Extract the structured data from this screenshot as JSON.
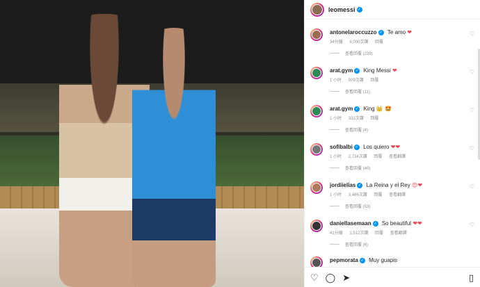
{
  "post": {
    "username": "leomessi",
    "image_alt": "Couple photo at night"
  },
  "comments": [
    {
      "user": "antonelaroccuzzo",
      "text": "Te amo",
      "emoji": "❤",
      "verified": true,
      "time": "34分鐘",
      "likes": "9,000次讚",
      "reply": "回覆",
      "translate": "",
      "replies": "查看回覆 (239)",
      "avatar_color": "#9b6b53"
    },
    {
      "user": "arat.gym",
      "text": "King Messi",
      "emoji": "❤",
      "verified": true,
      "time": "1 小时",
      "likes": "509次讚",
      "reply": "回覆",
      "translate": "",
      "replies": "查看回覆 (11)",
      "avatar_color": "#2e8b57"
    },
    {
      "user": "arat.gym",
      "text": "King",
      "emoji": "👑 🤩",
      "verified": true,
      "time": "1 小时",
      "likes": "332次讚",
      "reply": "回覆",
      "translate": "",
      "replies": "查看回覆 (4)",
      "avatar_color": "#2e8b57"
    },
    {
      "user": "sofibalbi",
      "text": "Los quiero",
      "emoji": "❤❤",
      "verified": true,
      "time": "1 小时",
      "likes": "2,734次讚",
      "reply": "回覆",
      "translate": "查看翻譯",
      "replies": "查看回覆 (40)",
      "avatar_color": "#777777"
    },
    {
      "user": "jordiielias",
      "text": "La Reina y el Rey",
      "emoji": "😍❤",
      "verified": true,
      "time": "1 小时",
      "likes": "3,486次讚",
      "reply": "回覆",
      "translate": "查看翻譯",
      "replies": "查看回覆 (53)",
      "avatar_color": "#b07a5a"
    },
    {
      "user": "daniellasemaan",
      "text": "So beautiful",
      "emoji": "❤❤",
      "verified": true,
      "time": "41分鐘",
      "likes": "1,512次讚",
      "reply": "回覆",
      "translate": "查看翻譯",
      "replies": "查看回覆 (6)",
      "avatar_color": "#333333"
    },
    {
      "user": "pepmorata",
      "text": "Muy guapis",
      "emoji": "",
      "verified": true,
      "time": "",
      "likes": "",
      "reply": "",
      "translate": "",
      "replies": "",
      "avatar_color": "#555555"
    }
  ],
  "footer": {
    "like_icon": "heart-outline-icon",
    "comment_icon": "comment-icon",
    "share_icon": "share-icon",
    "save_icon": "bookmark-icon"
  }
}
